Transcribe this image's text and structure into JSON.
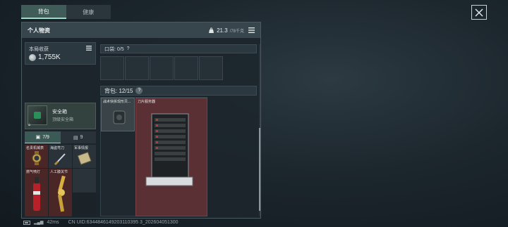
{
  "tabs": [
    {
      "label": "背包",
      "active": true
    },
    {
      "label": "健康",
      "active": false
    }
  ],
  "panel": {
    "title": "个人物资",
    "weight_icon": "weight-icon",
    "weight_current": "21.3",
    "weight_max": "/78千克",
    "menu_icon": "menu-icon"
  },
  "earnings": {
    "label": "本局收获",
    "value": "1,755K"
  },
  "safe_box": {
    "name": "安全箱",
    "subtitle": "顶级安全箱",
    "tab_items": "7/9",
    "tab_other": "9",
    "items": [
      {
        "label": "名贵机械表"
      },
      {
        "label": "海盗弯刀"
      },
      {
        "label": "军事情报"
      },
      {
        "label": "燃气喷灯"
      },
      {
        "label": "人工膝关节"
      }
    ]
  },
  "pocket": {
    "label": "口袋: 0/5",
    "help": "?"
  },
  "backpack": {
    "label": "背包: 12/15",
    "help": "?",
    "items": [
      {
        "label": "战术快拆现形贝..."
      },
      {
        "label": "刀片服务器"
      }
    ]
  },
  "footer": {
    "ping": "42ms",
    "uid": "CN UID:6344846149203110395 3_202604051300"
  },
  "colors": {
    "accent": "#9fd8c8",
    "item_red": "#5b3034"
  }
}
